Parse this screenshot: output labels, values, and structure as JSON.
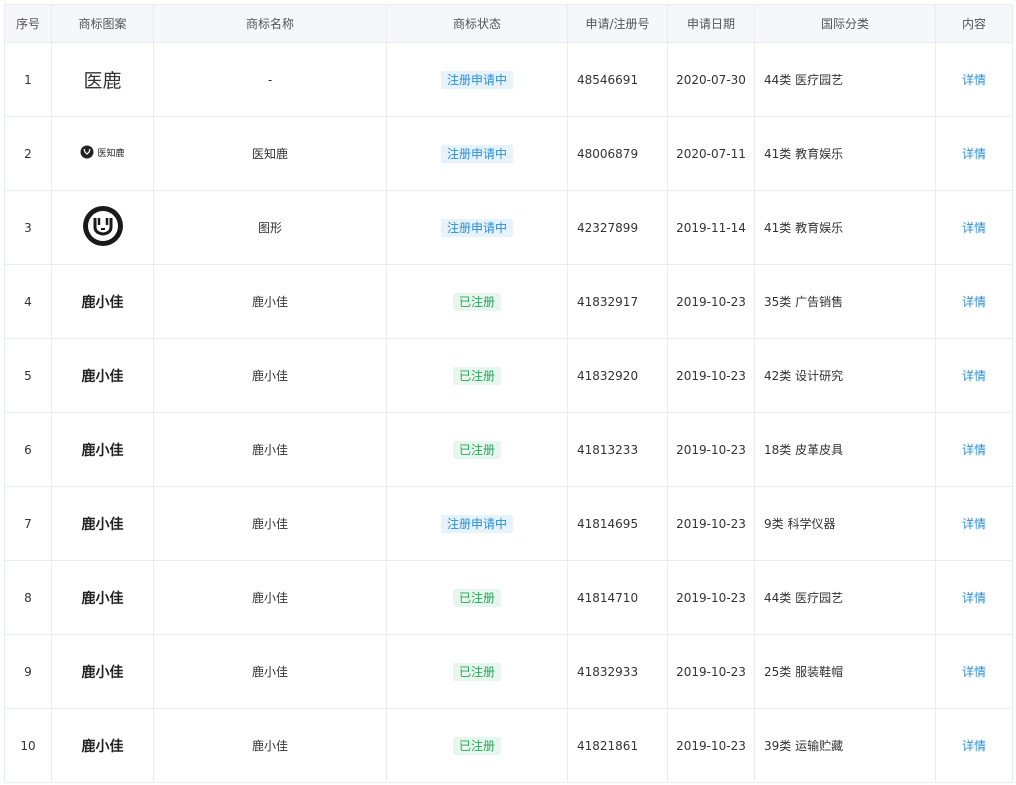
{
  "table": {
    "headers": [
      "序号",
      "商标图案",
      "商标名称",
      "商标状态",
      "申请/注册号",
      "申请日期",
      "国际分类",
      "内容"
    ],
    "rows": [
      {
        "index": "1",
        "logo_kind": "serif-text",
        "logo_text": "医鹿",
        "name": "-",
        "status": "注册申请中",
        "status_type": "applying",
        "reg_no": "48546691",
        "date": "2020-07-30",
        "class": "44类 医疗园艺",
        "detail": "详情"
      },
      {
        "index": "2",
        "logo_kind": "icon-with-text",
        "logo_text": "医知鹿",
        "name": "医知鹿",
        "status": "注册申请中",
        "status_type": "applying",
        "reg_no": "48006879",
        "date": "2020-07-11",
        "class": "41类 教育娱乐",
        "detail": "详情"
      },
      {
        "index": "3",
        "logo_kind": "graphic-circle",
        "logo_text": "",
        "name": "图形",
        "status": "注册申请中",
        "status_type": "applying",
        "reg_no": "42327899",
        "date": "2019-11-14",
        "class": "41类 教育娱乐",
        "detail": "详情"
      },
      {
        "index": "4",
        "logo_kind": "bold-text",
        "logo_text": "鹿小佳",
        "name": "鹿小佳",
        "status": "已注册",
        "status_type": "registered",
        "reg_no": "41832917",
        "date": "2019-10-23",
        "class": "35类 广告销售",
        "detail": "详情"
      },
      {
        "index": "5",
        "logo_kind": "bold-text",
        "logo_text": "鹿小佳",
        "name": "鹿小佳",
        "status": "已注册",
        "status_type": "registered",
        "reg_no": "41832920",
        "date": "2019-10-23",
        "class": "42类 设计研究",
        "detail": "详情"
      },
      {
        "index": "6",
        "logo_kind": "bold-text",
        "logo_text": "鹿小佳",
        "name": "鹿小佳",
        "status": "已注册",
        "status_type": "registered",
        "reg_no": "41813233",
        "date": "2019-10-23",
        "class": "18类 皮革皮具",
        "detail": "详情"
      },
      {
        "index": "7",
        "logo_kind": "bold-text",
        "logo_text": "鹿小佳",
        "name": "鹿小佳",
        "status": "注册申请中",
        "status_type": "applying",
        "reg_no": "41814695",
        "date": "2019-10-23",
        "class": "9类 科学仪器",
        "detail": "详情"
      },
      {
        "index": "8",
        "logo_kind": "bold-text",
        "logo_text": "鹿小佳",
        "name": "鹿小佳",
        "status": "已注册",
        "status_type": "registered",
        "reg_no": "41814710",
        "date": "2019-10-23",
        "class": "44类 医疗园艺",
        "detail": "详情"
      },
      {
        "index": "9",
        "logo_kind": "bold-text",
        "logo_text": "鹿小佳",
        "name": "鹿小佳",
        "status": "已注册",
        "status_type": "registered",
        "reg_no": "41832933",
        "date": "2019-10-23",
        "class": "25类 服装鞋帽",
        "detail": "详情"
      },
      {
        "index": "10",
        "logo_kind": "bold-text",
        "logo_text": "鹿小佳",
        "name": "鹿小佳",
        "status": "已注册",
        "status_type": "registered",
        "reg_no": "41821861",
        "date": "2019-10-23",
        "class": "39类 运输贮藏",
        "detail": "详情"
      }
    ]
  },
  "colors": {
    "header_bg": "#f5f7fa",
    "border": "#e8edf1",
    "link": "#2d8fd5",
    "applying_bg": "#e6f3fc",
    "applying_text": "#2d8fd5",
    "registered_bg": "#e8f7ee",
    "registered_text": "#27a55d"
  }
}
